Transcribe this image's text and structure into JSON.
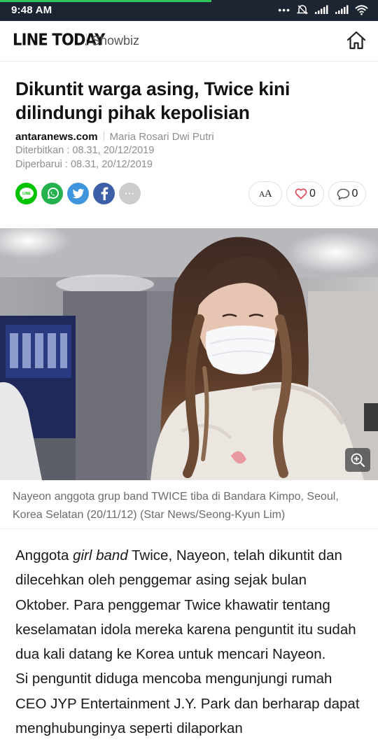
{
  "status_bar": {
    "time": "9:48 AM",
    "page_load_progress": 0.56
  },
  "header": {
    "logo_text": "LINE TODAY",
    "section": "Showbiz"
  },
  "article": {
    "title": "Dikuntit warga asing, Twice kini dilindungi pihak kepolisian",
    "source": "antaranews.com",
    "author": "Maria Rosari Dwi Putri",
    "published": "Diterbitkan : 08.31, 20/12/2019",
    "updated": "Diperbarui : 08.31, 20/12/2019"
  },
  "share": {
    "buttons": [
      "line-share",
      "whatsapp-share",
      "twitter-share",
      "facebook-share",
      "more-share"
    ],
    "line_label": "LINE",
    "more_label": "···",
    "font_size_label": "AA",
    "like_count": "0",
    "comment_count": "0"
  },
  "image": {
    "caption": "Nayeon anggota grup band TWICE tiba di Bandara Kimpo, Seoul, Korea Selatan (20/11/12) (Star News/Seong-Kyun Lim)"
  },
  "body": {
    "p1_before": "Anggota ",
    "p1_em": "girl band",
    "p1_after": " Twice, Nayeon, telah dikuntit dan dilecehkan oleh penggemar asing sejak bulan Oktober. Para penggemar Twice khawatir tentang keselamatan idola mereka karena penguntit itu sudah dua kali datang ke Korea untuk mencari Nayeon.",
    "p2": "Si penguntit diduga mencoba mengunjungi rumah CEO JYP Entertainment J.Y. Park dan berharap dapat menghubunginya seperti dilaporkan"
  },
  "colors": {
    "status_bar_bg": "#1c2531",
    "progress_green": "#2fc45a",
    "line_green": "#00c300",
    "whatsapp_green": "#26b14f",
    "twitter_blue": "#3f96dd",
    "facebook_blue": "#3d5fa8",
    "more_gray": "#cccccc",
    "like_red": "#e5495a"
  }
}
